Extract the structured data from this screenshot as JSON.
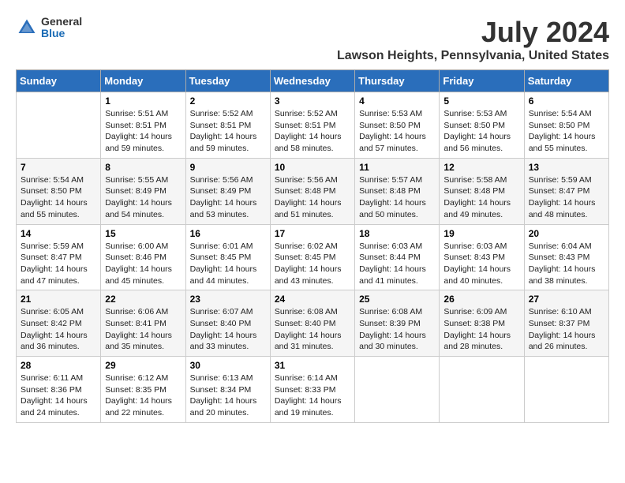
{
  "header": {
    "logo_general": "General",
    "logo_blue": "Blue",
    "main_title": "July 2024",
    "subtitle": "Lawson Heights, Pennsylvania, United States"
  },
  "days_of_week": [
    "Sunday",
    "Monday",
    "Tuesday",
    "Wednesday",
    "Thursday",
    "Friday",
    "Saturday"
  ],
  "weeks": [
    [
      {
        "day": "",
        "info": ""
      },
      {
        "day": "1",
        "info": "Sunrise: 5:51 AM\nSunset: 8:51 PM\nDaylight: 14 hours\nand 59 minutes."
      },
      {
        "day": "2",
        "info": "Sunrise: 5:52 AM\nSunset: 8:51 PM\nDaylight: 14 hours\nand 59 minutes."
      },
      {
        "day": "3",
        "info": "Sunrise: 5:52 AM\nSunset: 8:51 PM\nDaylight: 14 hours\nand 58 minutes."
      },
      {
        "day": "4",
        "info": "Sunrise: 5:53 AM\nSunset: 8:50 PM\nDaylight: 14 hours\nand 57 minutes."
      },
      {
        "day": "5",
        "info": "Sunrise: 5:53 AM\nSunset: 8:50 PM\nDaylight: 14 hours\nand 56 minutes."
      },
      {
        "day": "6",
        "info": "Sunrise: 5:54 AM\nSunset: 8:50 PM\nDaylight: 14 hours\nand 55 minutes."
      }
    ],
    [
      {
        "day": "7",
        "info": "Sunrise: 5:54 AM\nSunset: 8:50 PM\nDaylight: 14 hours\nand 55 minutes."
      },
      {
        "day": "8",
        "info": "Sunrise: 5:55 AM\nSunset: 8:49 PM\nDaylight: 14 hours\nand 54 minutes."
      },
      {
        "day": "9",
        "info": "Sunrise: 5:56 AM\nSunset: 8:49 PM\nDaylight: 14 hours\nand 53 minutes."
      },
      {
        "day": "10",
        "info": "Sunrise: 5:56 AM\nSunset: 8:48 PM\nDaylight: 14 hours\nand 51 minutes."
      },
      {
        "day": "11",
        "info": "Sunrise: 5:57 AM\nSunset: 8:48 PM\nDaylight: 14 hours\nand 50 minutes."
      },
      {
        "day": "12",
        "info": "Sunrise: 5:58 AM\nSunset: 8:48 PM\nDaylight: 14 hours\nand 49 minutes."
      },
      {
        "day": "13",
        "info": "Sunrise: 5:59 AM\nSunset: 8:47 PM\nDaylight: 14 hours\nand 48 minutes."
      }
    ],
    [
      {
        "day": "14",
        "info": "Sunrise: 5:59 AM\nSunset: 8:47 PM\nDaylight: 14 hours\nand 47 minutes."
      },
      {
        "day": "15",
        "info": "Sunrise: 6:00 AM\nSunset: 8:46 PM\nDaylight: 14 hours\nand 45 minutes."
      },
      {
        "day": "16",
        "info": "Sunrise: 6:01 AM\nSunset: 8:45 PM\nDaylight: 14 hours\nand 44 minutes."
      },
      {
        "day": "17",
        "info": "Sunrise: 6:02 AM\nSunset: 8:45 PM\nDaylight: 14 hours\nand 43 minutes."
      },
      {
        "day": "18",
        "info": "Sunrise: 6:03 AM\nSunset: 8:44 PM\nDaylight: 14 hours\nand 41 minutes."
      },
      {
        "day": "19",
        "info": "Sunrise: 6:03 AM\nSunset: 8:43 PM\nDaylight: 14 hours\nand 40 minutes."
      },
      {
        "day": "20",
        "info": "Sunrise: 6:04 AM\nSunset: 8:43 PM\nDaylight: 14 hours\nand 38 minutes."
      }
    ],
    [
      {
        "day": "21",
        "info": "Sunrise: 6:05 AM\nSunset: 8:42 PM\nDaylight: 14 hours\nand 36 minutes."
      },
      {
        "day": "22",
        "info": "Sunrise: 6:06 AM\nSunset: 8:41 PM\nDaylight: 14 hours\nand 35 minutes."
      },
      {
        "day": "23",
        "info": "Sunrise: 6:07 AM\nSunset: 8:40 PM\nDaylight: 14 hours\nand 33 minutes."
      },
      {
        "day": "24",
        "info": "Sunrise: 6:08 AM\nSunset: 8:40 PM\nDaylight: 14 hours\nand 31 minutes."
      },
      {
        "day": "25",
        "info": "Sunrise: 6:08 AM\nSunset: 8:39 PM\nDaylight: 14 hours\nand 30 minutes."
      },
      {
        "day": "26",
        "info": "Sunrise: 6:09 AM\nSunset: 8:38 PM\nDaylight: 14 hours\nand 28 minutes."
      },
      {
        "day": "27",
        "info": "Sunrise: 6:10 AM\nSunset: 8:37 PM\nDaylight: 14 hours\nand 26 minutes."
      }
    ],
    [
      {
        "day": "28",
        "info": "Sunrise: 6:11 AM\nSunset: 8:36 PM\nDaylight: 14 hours\nand 24 minutes."
      },
      {
        "day": "29",
        "info": "Sunrise: 6:12 AM\nSunset: 8:35 PM\nDaylight: 14 hours\nand 22 minutes."
      },
      {
        "day": "30",
        "info": "Sunrise: 6:13 AM\nSunset: 8:34 PM\nDaylight: 14 hours\nand 20 minutes."
      },
      {
        "day": "31",
        "info": "Sunrise: 6:14 AM\nSunset: 8:33 PM\nDaylight: 14 hours\nand 19 minutes."
      },
      {
        "day": "",
        "info": ""
      },
      {
        "day": "",
        "info": ""
      },
      {
        "day": "",
        "info": ""
      }
    ]
  ]
}
